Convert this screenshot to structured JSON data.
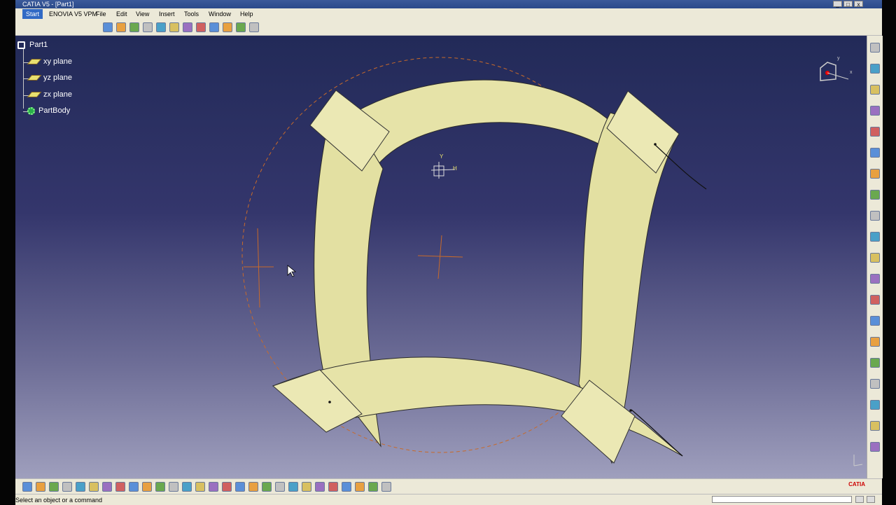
{
  "window": {
    "title": "CATIA V5 - [Part1]",
    "controls": [
      "_",
      "□",
      "x"
    ]
  },
  "menu": {
    "start": "Start",
    "enovia": "ENOVIA V5 VPM",
    "file": "File",
    "edit": "Edit",
    "view": "View",
    "insert": "Insert",
    "tools": "Tools",
    "window": "Window",
    "help": "Help"
  },
  "tree": {
    "root": "Part1",
    "items": [
      "xy plane",
      "yz plane",
      "zx plane",
      "PartBody"
    ]
  },
  "compass": {
    "x_label": "x",
    "y_label": "y"
  },
  "axis": {
    "y_label": "Y",
    "h_label": "H"
  },
  "status": {
    "message": "Select an object or a command",
    "command_input": ""
  },
  "brand": "CATIA",
  "colors": {
    "viewport_top": "#222a58",
    "viewport_bottom": "#9f9fbd",
    "surface_fill": "#e6e3a8",
    "construction_orange": "#c86a2a",
    "selection_blue": "#316ac5"
  },
  "icons": {
    "top_toolbar": [
      "fly-mode-icon",
      "fit-all-icon",
      "pan-icon",
      "rotate-icon",
      "zoom-in-icon",
      "zoom-out-icon",
      "normal-view-icon",
      "iso-view-icon",
      "shading-icon",
      "hide-show-icon",
      "swap-space-icon",
      "render-style-icon"
    ],
    "bottom_toolbar": [
      "new-icon",
      "open-icon",
      "save-icon",
      "print-icon",
      "cut-icon",
      "copy-icon",
      "paste-icon",
      "undo-icon",
      "redo-icon",
      "whats-this-icon",
      "update-icon",
      "measure-icon",
      "annotation-icon",
      "catalog-icon",
      "sketcher-icon",
      "join-icon",
      "healing-icon",
      "split-icon",
      "trim-icon",
      "boundary-icon",
      "extract-icon",
      "fillet-icon",
      "translate-icon",
      "grid-icon",
      "snap-icon",
      "constraint-icon",
      "analysis-icon",
      "law-icon"
    ],
    "right_toolbar": [
      "sketch-icon",
      "point-icon",
      "line-icon",
      "plane-icon",
      "projection-icon",
      "intersection-icon",
      "circle-icon",
      "spline-icon",
      "helix-icon",
      "extrude-icon",
      "revolve-icon",
      "sphere-icon",
      "cylinder-icon",
      "offset-icon",
      "sweep-icon",
      "fill-icon",
      "multisection-icon",
      "blend-icon",
      "boolean-icon",
      "axis-system-icon"
    ]
  }
}
